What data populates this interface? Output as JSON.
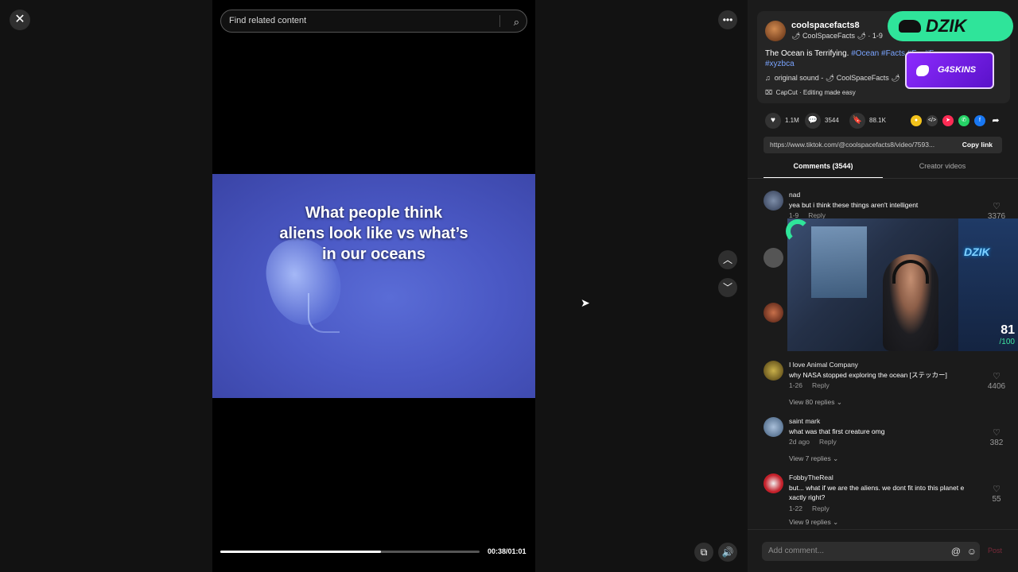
{
  "player": {
    "close_icon": "✕",
    "search_placeholder": "Find related content",
    "caption": "What people think\naliens look like vs what’s\nin our oceans",
    "time": "00:38/01:01",
    "progress": 0.62,
    "more_icon": "•••",
    "up_icon": "︿",
    "down_icon": "﹀"
  },
  "post": {
    "username": "coolspacefacts8",
    "display_name": "CoolSpaceFacts",
    "date": "1-9",
    "desc_text": "The Ocean is Terrifying.",
    "desc_tags": "#Ocean #Facts #F... #F...",
    "desc_tags_2": "#xyzbca",
    "sound": "original sound - 🌶 CoolSpaceFacts 🌶",
    "capcut": "CapCut · Editing made easy",
    "likes": "1.1M",
    "comments": "3544",
    "saves": "88.1K",
    "link": "https://www.tiktok.com/@coolspacefacts8/video/7593...",
    "copy_link": "Copy link"
  },
  "tabs": {
    "comments": "Comments (3544)",
    "creator": "Creator videos"
  },
  "comments": [
    {
      "name": "nad",
      "text": "yea but i think these things aren't intelligent",
      "date": "1-9",
      "reply": "Reply",
      "likes": "3376"
    },
    {
      "name": "I love Animal Company",
      "text": "why NASA stopped exploring the ocean [ステッカー]",
      "date": "1-26",
      "reply": "Reply",
      "likes": "4406",
      "view_replies": "View 80 replies"
    },
    {
      "name": "saint mark",
      "text": "what was that first creature omg",
      "date": "2d ago",
      "reply": "Reply",
      "likes": "382",
      "view_replies": "View 7 replies"
    },
    {
      "name": "FobbyTheReal",
      "text": "but... what if we are the aliens. we dont fit into this planet e xactly right?",
      "date": "1-22",
      "reply": "Reply",
      "likes": "55",
      "view_replies": "View 9 replies"
    }
  ],
  "overlays": {
    "dzik": "DZIK",
    "g4skins": "G4SKINS",
    "cam_logo": "DZIK",
    "score": "81",
    "score_total": "/100"
  },
  "add_comment": {
    "placeholder": "Add comment...",
    "post": "Post"
  }
}
